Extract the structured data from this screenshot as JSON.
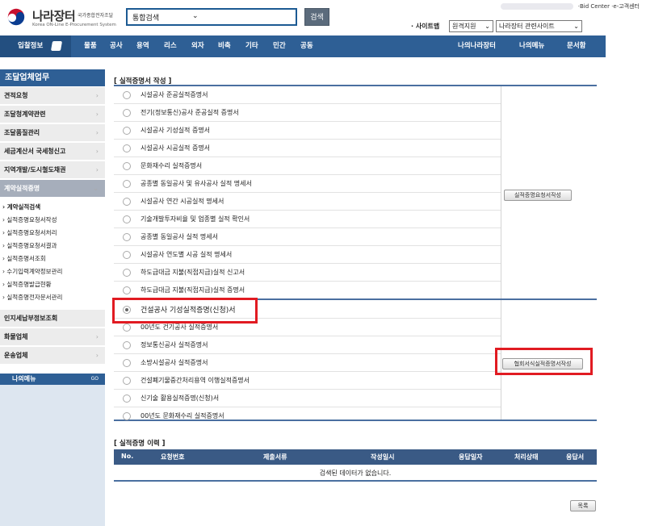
{
  "header": {
    "logo_name": "나라장터",
    "logo_sub1": "국가종합전자조달",
    "logo_sub2": "Korea ON-Line E-Procurement System",
    "search_select": "통합검색",
    "search_button": "검색",
    "util_links": "·Bid Center  ·e-고객센터",
    "sitemap_label": "· 사이트맵",
    "sitemap_select": "원격지원",
    "related_select": "나라장터 관련사이트"
  },
  "nav": {
    "first": "입찰정보",
    "items": [
      "물품",
      "공사",
      "용역",
      "리스",
      "외자",
      "비축",
      "기타",
      "민간",
      "공동"
    ],
    "right_items": [
      "나의나라장터",
      "나의메뉴",
      "문서함"
    ]
  },
  "sidebar": {
    "title": "조달업체업무",
    "items": [
      "견적요청",
      "조달청계약관련",
      "조달품질관리",
      "세금계산서 국세청신고",
      "지역개발/도시철도채권",
      "계약실적증명"
    ],
    "subitems": [
      "› 계약실적검색",
      "› 실적증명요청서작성",
      "› 실적증명요청서처리",
      "› 실적증명요청서결과",
      "› 실적증명서조회",
      "› 수기입력계약정보관리",
      "› 실적증명발급현황",
      "› 실적증명전자문서관리"
    ],
    "items2": [
      "인지세납부정보조회",
      "화물업체",
      "운송업체"
    ],
    "mymenu": "나의메뉴",
    "mymenu_go": "GO"
  },
  "form": {
    "title": "[ 실적증명서 작성 ]",
    "group1": [
      "시설공사 준공실적증명서",
      "전기(정보통신)공사 준공실적 증명서",
      "시설공사 기성실적 증명서",
      "시설공사 시공실적 증명서",
      "문화재수리 실적증명서",
      "공종별 동일공사 및 유사공사 실적 명세서",
      "시설공사 연간 시공실적 명세서",
      "기술개발투자비율 및 업종별 실적 확인서",
      "공종별 동일공사 실적 명세서",
      "시설공사 연도별 시공 실적 명세서",
      "하도급대금 지불(직접지급)실적 신고서",
      "하도급대금 지불(직접지급)실적 증명서"
    ],
    "group2": [
      "건설공사 기성실적증명(신청)서",
      "00년도 건기공사 실적증명서",
      "정보통신공사 실적증명서",
      "소방시설공사 실적증명서",
      "건설폐기물중간처리용역 이행실적증명서",
      "신기술 활용실적증명(신청)서",
      "00년도 문화재수리 실적증명서"
    ],
    "selected_group2_index": 0,
    "group1_button": "실적증명요청서작성",
    "group2_button": "협회서식실적증명서작성"
  },
  "history": {
    "title": "[ 실적증명 이력 ]",
    "columns": [
      "No.",
      "요청번호",
      "제출서류",
      "작성일시",
      "응답일자",
      "처리상태",
      "응답서"
    ],
    "empty": "검색된 데이터가 없습니다."
  },
  "list_button": "목록",
  "colors": {
    "nav": "#2e5f95",
    "highlight": "#e11b22",
    "active_sidebar": "#a6aebb"
  }
}
